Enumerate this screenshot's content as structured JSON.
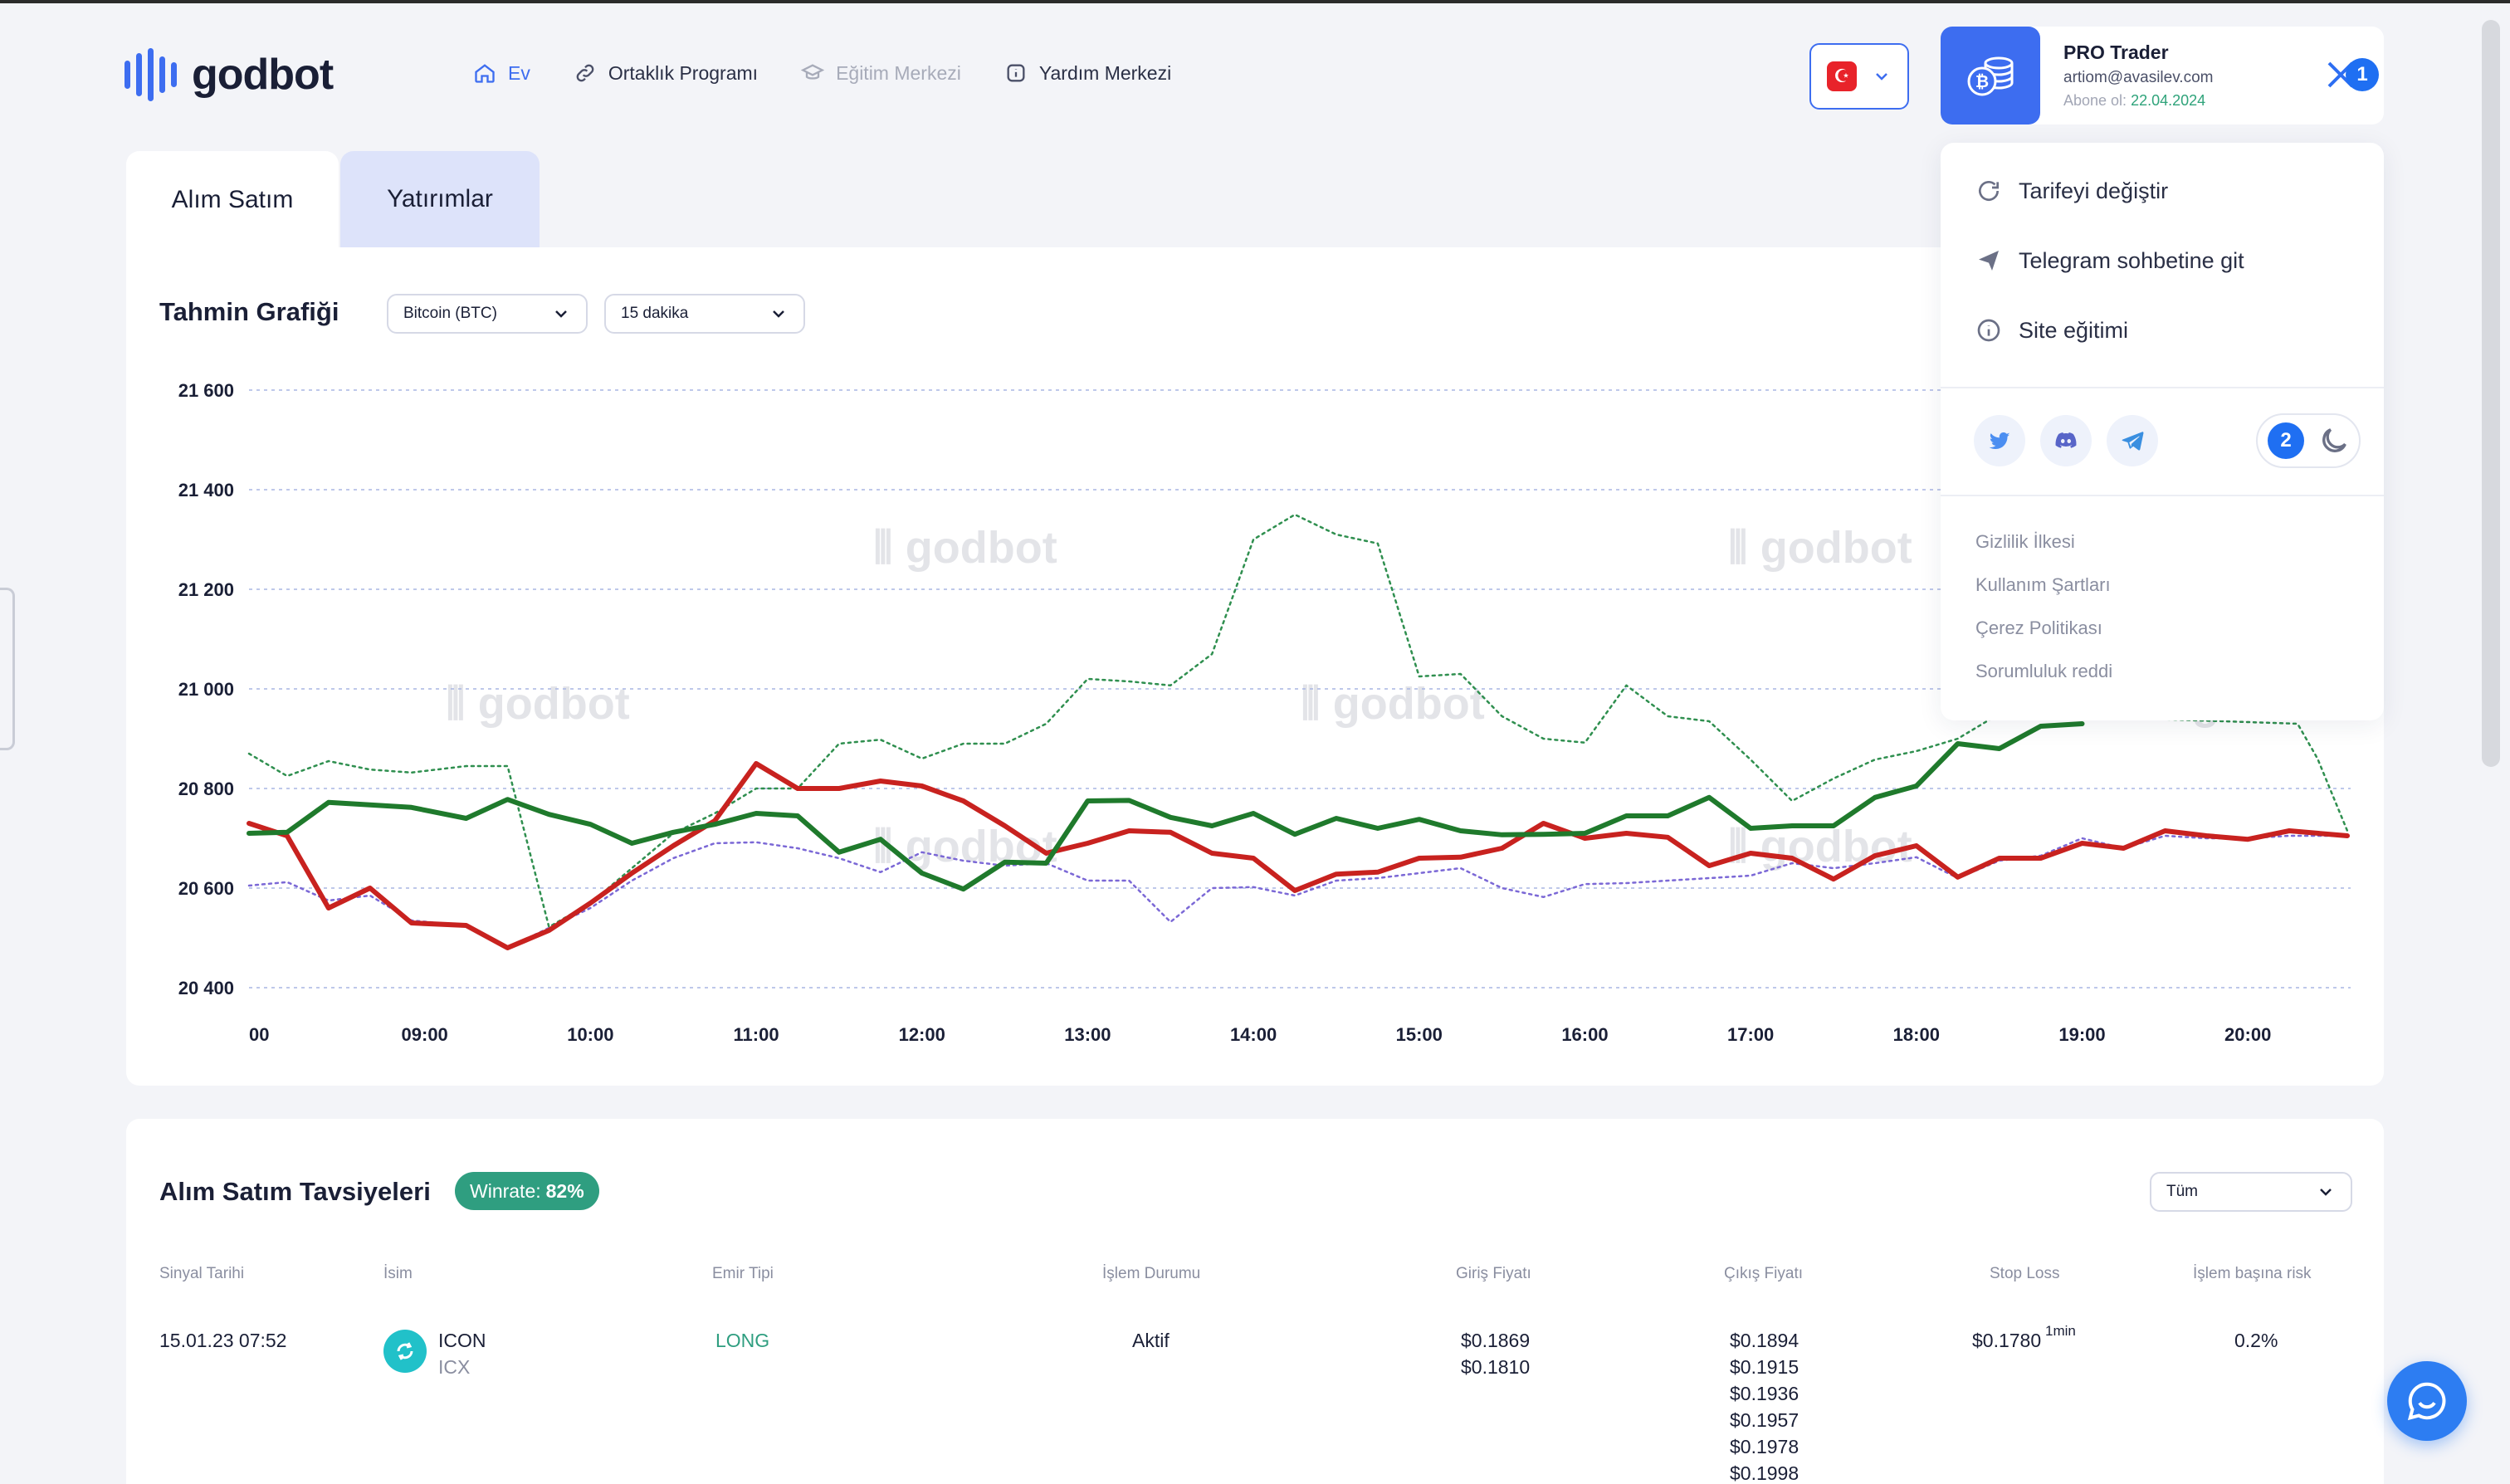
{
  "brand": {
    "name": "godbot"
  },
  "nav": {
    "items": [
      {
        "label": "Ev",
        "state": "active",
        "icon": "home-icon"
      },
      {
        "label": "Ortaklık Programı",
        "state": "normal",
        "icon": "link-icon"
      },
      {
        "label": "Eğitim Merkezi",
        "state": "disabled",
        "icon": "graduation-cap-icon"
      },
      {
        "label": "Yardım Merkezi",
        "state": "normal",
        "icon": "info-icon"
      }
    ]
  },
  "language": {
    "flag": "tr-flag-icon",
    "flag_glyph": "☪"
  },
  "profile": {
    "plan": "PRO Trader",
    "email": "artiom@avasilev.com",
    "subscription_label": "Abone ol:",
    "subscription_date": "22.04.2024",
    "annotation_1": "1",
    "annotation_2": "2"
  },
  "menu": {
    "items": [
      {
        "label": "Tarifeyi değiştir",
        "icon": "refresh-icon"
      },
      {
        "label": "Telegram sohbetine git",
        "icon": "send-icon"
      },
      {
        "label": "Site eğitimi",
        "icon": "info-icon"
      }
    ],
    "socials": [
      "twitter-icon",
      "discord-icon",
      "telegram-icon"
    ],
    "footer_links": [
      "Gizlilik İlkesi",
      "Kullanım Şartları",
      "Çerez Politikası",
      "Sorumluluk reddi"
    ]
  },
  "tabs": [
    {
      "label": "Alım Satım",
      "active": true
    },
    {
      "label": "Yatırımlar",
      "active": false
    }
  ],
  "chart_panel": {
    "title": "Tahmin Grafiği",
    "asset_select": "Bitcoin (BTC)",
    "interval_select": "15 dakika",
    "watermark": "godbot"
  },
  "chart_data": {
    "type": "line",
    "ylim": [
      20400,
      21600
    ],
    "y_ticks": [
      "20 400",
      "20 600",
      "20 800",
      "21 000",
      "21 200",
      "21 400",
      "21 600"
    ],
    "y_tick_values": [
      20400,
      20600,
      20800,
      21000,
      21200,
      21400,
      21600
    ],
    "x_ticks": [
      "00",
      "09:00",
      "10:00",
      "11:00",
      "12:00",
      "13:00",
      "14:00",
      "15:00",
      "16:00",
      "17:00",
      "18:00",
      "19:00",
      "20:00"
    ],
    "x_tick_hours": [
      8.0,
      9.0,
      10.0,
      11.0,
      12.0,
      13.0,
      14.0,
      15.0,
      16.0,
      17.0,
      18.0,
      19.0,
      20.0
    ],
    "xlim": [
      7.94,
      20.62
    ],
    "grid": true,
    "colors": {
      "red": "#c8221f",
      "green": "#1f7a2c",
      "green_dotted": "#2f8f4f",
      "purple_dotted": "#7b68d6"
    },
    "series": [
      {
        "style": "solid",
        "color": "red",
        "points": [
          [
            7.94,
            20730
          ],
          [
            8.17,
            20705
          ],
          [
            8.42,
            20560
          ],
          [
            8.67,
            20600
          ],
          [
            8.92,
            20530
          ],
          [
            9.25,
            20525
          ],
          [
            9.5,
            20480
          ],
          [
            9.75,
            20515
          ],
          [
            10.0,
            20570
          ],
          [
            10.25,
            20630
          ],
          [
            10.5,
            20685
          ],
          [
            10.75,
            20735
          ],
          [
            11.0,
            20850
          ],
          [
            11.25,
            20800
          ],
          [
            11.5,
            20800
          ],
          [
            11.75,
            20815
          ],
          [
            12.0,
            20805
          ],
          [
            12.25,
            20775
          ],
          [
            12.5,
            20725
          ],
          [
            12.75,
            20670
          ],
          [
            13.0,
            20690
          ],
          [
            13.25,
            20715
          ],
          [
            13.5,
            20712
          ],
          [
            13.75,
            20670
          ],
          [
            14.0,
            20660
          ],
          [
            14.25,
            20595
          ],
          [
            14.5,
            20628
          ],
          [
            14.75,
            20632
          ],
          [
            15.0,
            20660
          ],
          [
            15.25,
            20662
          ],
          [
            15.5,
            20680
          ],
          [
            15.75,
            20730
          ],
          [
            16.0,
            20700
          ],
          [
            16.25,
            20710
          ],
          [
            16.5,
            20702
          ],
          [
            16.75,
            20645
          ],
          [
            17.0,
            20670
          ],
          [
            17.25,
            20660
          ],
          [
            17.5,
            20618
          ],
          [
            17.75,
            20665
          ],
          [
            18.0,
            20685
          ],
          [
            18.25,
            20622
          ],
          [
            18.5,
            20660
          ],
          [
            18.75,
            20660
          ],
          [
            19.0,
            20690
          ],
          [
            19.25,
            20680
          ],
          [
            19.5,
            20715
          ],
          [
            19.75,
            20705
          ],
          [
            20.0,
            20698
          ],
          [
            20.25,
            20715
          ],
          [
            20.6,
            20705
          ]
        ]
      },
      {
        "style": "solid",
        "color": "green",
        "points": [
          [
            7.94,
            20710
          ],
          [
            8.17,
            20712
          ],
          [
            8.42,
            20772
          ],
          [
            8.67,
            20767
          ],
          [
            8.92,
            20762
          ],
          [
            9.25,
            20740
          ],
          [
            9.5,
            20778
          ],
          [
            9.75,
            20748
          ],
          [
            10.0,
            20728
          ],
          [
            10.25,
            20690
          ],
          [
            10.5,
            20712
          ],
          [
            10.75,
            20728
          ],
          [
            11.0,
            20750
          ],
          [
            11.25,
            20745
          ],
          [
            11.5,
            20672
          ],
          [
            11.75,
            20698
          ],
          [
            12.0,
            20630
          ],
          [
            12.25,
            20598
          ],
          [
            12.5,
            20652
          ],
          [
            12.75,
            20650
          ],
          [
            13.0,
            20775
          ],
          [
            13.25,
            20776
          ],
          [
            13.5,
            20742
          ],
          [
            13.75,
            20725
          ],
          [
            14.0,
            20750
          ],
          [
            14.25,
            20708
          ],
          [
            14.5,
            20740
          ],
          [
            14.75,
            20720
          ],
          [
            15.0,
            20738
          ],
          [
            15.25,
            20715
          ],
          [
            15.5,
            20707
          ],
          [
            15.75,
            20708
          ],
          [
            16.0,
            20710
          ],
          [
            16.25,
            20745
          ],
          [
            16.5,
            20745
          ],
          [
            16.75,
            20782
          ],
          [
            17.0,
            20720
          ],
          [
            17.25,
            20725
          ],
          [
            17.5,
            20725
          ],
          [
            17.75,
            20782
          ],
          [
            18.0,
            20805
          ],
          [
            18.25,
            20890
          ],
          [
            18.5,
            20880
          ],
          [
            18.75,
            20925
          ],
          [
            19.0,
            20930
          ]
        ]
      },
      {
        "style": "dotted",
        "color": "green_dotted",
        "points": [
          [
            7.94,
            20870
          ],
          [
            8.17,
            20825
          ],
          [
            8.42,
            20855
          ],
          [
            8.67,
            20838
          ],
          [
            8.92,
            20832
          ],
          [
            9.25,
            20845
          ],
          [
            9.5,
            20845
          ],
          [
            9.75,
            20522
          ],
          [
            10.0,
            20570
          ],
          [
            10.25,
            20640
          ],
          [
            10.5,
            20710
          ],
          [
            10.75,
            20750
          ],
          [
            11.0,
            20800
          ],
          [
            11.25,
            20800
          ],
          [
            11.5,
            20890
          ],
          [
            11.75,
            20898
          ],
          [
            12.0,
            20860
          ],
          [
            12.25,
            20890
          ],
          [
            12.5,
            20890
          ],
          [
            12.75,
            20930
          ],
          [
            13.0,
            21020
          ],
          [
            13.25,
            21015
          ],
          [
            13.5,
            21007
          ],
          [
            13.75,
            21070
          ],
          [
            14.0,
            21300
          ],
          [
            14.25,
            21350
          ],
          [
            14.5,
            21310
          ],
          [
            14.75,
            21292
          ],
          [
            15.0,
            21025
          ],
          [
            15.25,
            21030
          ],
          [
            15.5,
            20945
          ],
          [
            15.75,
            20900
          ],
          [
            16.0,
            20892
          ],
          [
            16.25,
            21007
          ],
          [
            16.5,
            20945
          ],
          [
            16.75,
            20935
          ],
          [
            17.0,
            20858
          ],
          [
            17.25,
            20775
          ],
          [
            17.5,
            20820
          ],
          [
            17.75,
            20858
          ],
          [
            18.0,
            20875
          ],
          [
            18.25,
            20900
          ],
          [
            18.5,
            20950
          ],
          [
            20.3,
            20930
          ],
          [
            20.42,
            20860
          ],
          [
            20.6,
            20715
          ]
        ]
      },
      {
        "style": "dotted",
        "color": "purple_dotted",
        "points": [
          [
            7.94,
            20605
          ],
          [
            8.17,
            20612
          ],
          [
            8.42,
            20575
          ],
          [
            8.67,
            20585
          ],
          [
            8.92,
            20535
          ],
          [
            9.25,
            20525
          ],
          [
            9.5,
            20480
          ],
          [
            9.75,
            20520
          ],
          [
            10.0,
            20560
          ],
          [
            10.25,
            20615
          ],
          [
            10.5,
            20660
          ],
          [
            10.75,
            20690
          ],
          [
            11.0,
            20692
          ],
          [
            11.25,
            20680
          ],
          [
            11.5,
            20660
          ],
          [
            11.75,
            20632
          ],
          [
            12.0,
            20672
          ],
          [
            12.25,
            20655
          ],
          [
            12.5,
            20645
          ],
          [
            12.75,
            20650
          ],
          [
            13.0,
            20615
          ],
          [
            13.25,
            20615
          ],
          [
            13.5,
            20532
          ],
          [
            13.75,
            20600
          ],
          [
            14.0,
            20602
          ],
          [
            14.25,
            20585
          ],
          [
            14.5,
            20615
          ],
          [
            14.75,
            20620
          ],
          [
            15.0,
            20630
          ],
          [
            15.25,
            20640
          ],
          [
            15.5,
            20600
          ],
          [
            15.75,
            20582
          ],
          [
            16.0,
            20608
          ],
          [
            16.25,
            20610
          ],
          [
            16.5,
            20615
          ],
          [
            16.75,
            20620
          ],
          [
            17.0,
            20625
          ],
          [
            17.25,
            20650
          ],
          [
            17.5,
            20640
          ],
          [
            17.75,
            20650
          ],
          [
            18.0,
            20662
          ],
          [
            18.25,
            20620
          ],
          [
            18.5,
            20655
          ],
          [
            18.75,
            20665
          ],
          [
            19.0,
            20700
          ],
          [
            19.25,
            20680
          ],
          [
            19.5,
            20705
          ],
          [
            19.75,
            20700
          ],
          [
            20.0,
            20700
          ],
          [
            20.25,
            20705
          ],
          [
            20.6,
            20705
          ]
        ]
      }
    ]
  },
  "recommendations": {
    "title": "Alım Satım Tavsiyeleri",
    "winrate_label": "Winrate:",
    "winrate_value": "82%",
    "filter": "Tüm",
    "columns": [
      "Sinyal Tarihi",
      "İsim",
      "Emir Tipi",
      "İşlem Durumu",
      "Giriş Fiyatı",
      "Çıkış Fiyatı",
      "Stop Loss",
      "İşlem başına risk"
    ],
    "rows": [
      {
        "date": "15.01.23 07:52",
        "name": "ICON",
        "ticker": "ICX",
        "order_type": "LONG",
        "status": "Aktif",
        "entry": [
          "$0.1869",
          "$0.1810"
        ],
        "exit": [
          "$0.1894",
          "$0.1915",
          "$0.1936",
          "$0.1957",
          "$0.1978",
          "$0.1998"
        ],
        "stop_loss": "$0.1780",
        "stop_loss_tag": "1min",
        "risk": "0.2%"
      }
    ]
  },
  "colors": {
    "accent": "#3d6df0",
    "green": "#2f9e80",
    "page_bg": "#f3f4f8"
  }
}
